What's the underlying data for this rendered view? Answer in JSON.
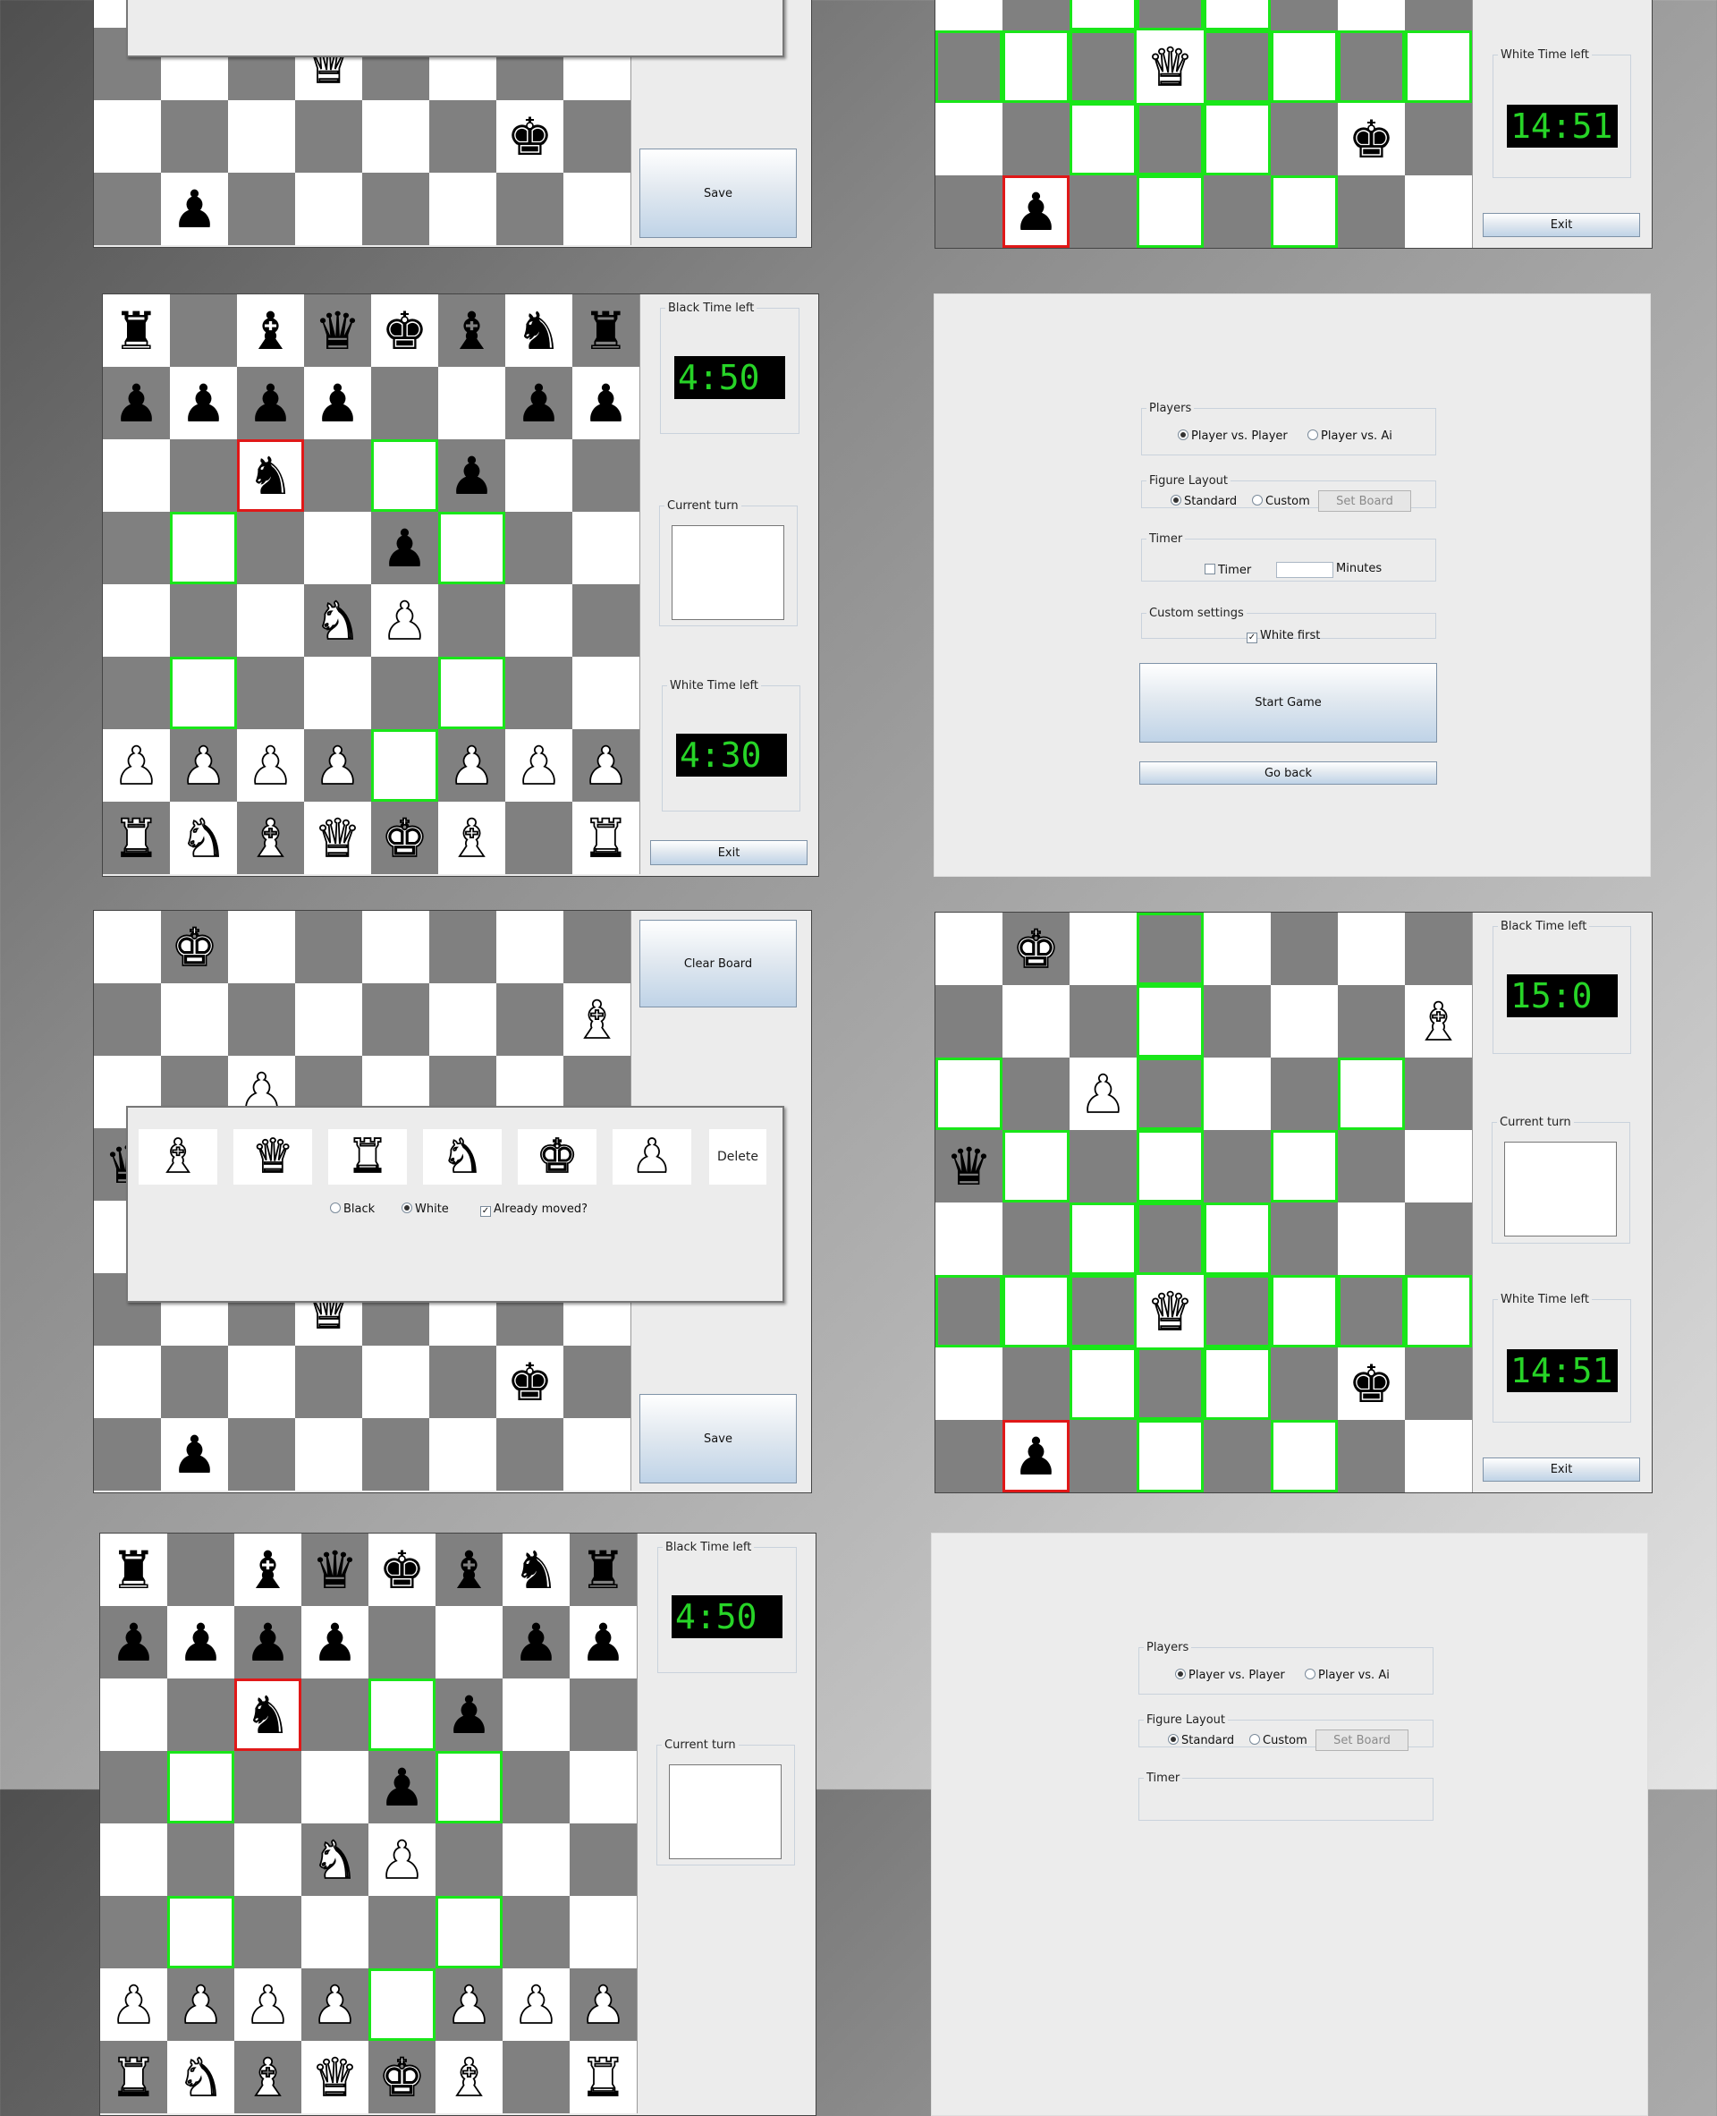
{
  "labels": {
    "black_time": "Black Time left",
    "white_time": "White Time left",
    "current_turn": "Current turn",
    "exit": "Exit",
    "save": "Save",
    "clear_board": "Clear Board",
    "players": "Players",
    "pvp": "Player vs. Player",
    "pva": "Player vs. Ai",
    "figure_layout": "Figure Layout",
    "standard": "Standard",
    "custom": "Custom",
    "set_board": "Set Board",
    "timer": "Timer",
    "timer_check": "Timer",
    "minutes": "Minutes",
    "custom_settings": "Custom settings",
    "white_first": "White first",
    "start_game": "Start Game",
    "go_back": "Go back",
    "delete": "Delete",
    "black": "Black",
    "white": "White",
    "already_moved": "Already moved?"
  },
  "timers": {
    "endgame_black": "15:0",
    "endgame_white": "14:51",
    "opening_black": "4:50",
    "opening_white": "4:30"
  },
  "boards": {
    "opening": [
      [
        "br",
        "",
        "bb",
        "bq",
        "bk",
        "bb",
        "bn",
        "br"
      ],
      [
        "bp",
        "bp",
        "bp",
        "bp",
        "",
        "",
        "bp",
        "bp"
      ],
      [
        "",
        "",
        "bn",
        "",
        "",
        "bp",
        "",
        ""
      ],
      [
        "",
        "",
        "",
        "",
        "bp",
        "",
        "",
        ""
      ],
      [
        "",
        "",
        "",
        "wn",
        "wp",
        "",
        "",
        ""
      ],
      [
        "",
        "",
        "",
        "",
        "",
        "",
        "",
        ""
      ],
      [
        "wp",
        "wp",
        "wp",
        "wp",
        "",
        "wp",
        "wp",
        "wp"
      ],
      [
        "wr",
        "wn",
        "wb",
        "wq",
        "wk",
        "wb",
        "",
        "wr"
      ]
    ],
    "endgame": [
      [
        "",
        "wk",
        "",
        "",
        "",
        "",
        "",
        ""
      ],
      [
        "",
        "",
        "",
        "",
        "",
        "",
        "",
        "wb"
      ],
      [
        "",
        "",
        "wp",
        "",
        "",
        "",
        "",
        ""
      ],
      [
        "bq",
        "",
        "",
        "",
        "",
        "",
        "",
        ""
      ],
      [
        "",
        "",
        "",
        "",
        "",
        "",
        "",
        ""
      ],
      [
        "",
        "",
        "",
        "wq",
        "",
        "",
        "",
        ""
      ],
      [
        "",
        "",
        "",
        "",
        "",
        "",
        "bk",
        ""
      ],
      [
        "",
        "bp",
        "",
        "",
        "",
        "",
        "",
        ""
      ]
    ],
    "editor": [
      [
        "",
        "wk",
        "",
        "",
        "",
        "",
        "",
        ""
      ],
      [
        "",
        "",
        "",
        "",
        "",
        "",
        "",
        "wb"
      ],
      [
        "",
        "",
        "wp",
        "",
        "",
        "",
        "",
        ""
      ],
      [
        "bq",
        "",
        "",
        "",
        "",
        "",
        "",
        ""
      ],
      [
        "",
        "",
        "",
        "",
        "",
        "",
        "",
        ""
      ],
      [
        "",
        "",
        "",
        "wq",
        "",
        "",
        "",
        ""
      ],
      [
        "",
        "",
        "",
        "",
        "",
        "",
        "bk",
        ""
      ],
      [
        "",
        "bp",
        "",
        "",
        "",
        "",
        "",
        ""
      ]
    ]
  },
  "highlights": {
    "opening": {
      "green": [
        [
          2,
          4
        ],
        [
          3,
          1
        ],
        [
          3,
          5
        ],
        [
          5,
          1
        ],
        [
          5,
          5
        ],
        [
          6,
          4
        ]
      ],
      "red": [
        [
          2,
          2
        ]
      ]
    },
    "endgame": {
      "green": [
        [
          0,
          3
        ],
        [
          1,
          3
        ],
        [
          2,
          0
        ],
        [
          2,
          3
        ],
        [
          2,
          6
        ],
        [
          3,
          1
        ],
        [
          3,
          3
        ],
        [
          3,
          5
        ],
        [
          4,
          2
        ],
        [
          4,
          3
        ],
        [
          4,
          4
        ],
        [
          5,
          0
        ],
        [
          5,
          1
        ],
        [
          5,
          2
        ],
        [
          5,
          4
        ],
        [
          5,
          5
        ],
        [
          5,
          6
        ],
        [
          5,
          7
        ],
        [
          6,
          2
        ],
        [
          6,
          3
        ],
        [
          6,
          4
        ],
        [
          7,
          3
        ],
        [
          7,
          5
        ]
      ],
      "red": [
        [
          7,
          1
        ]
      ]
    },
    "editor": {
      "green": [],
      "red": []
    }
  },
  "palette": [
    {
      "piece": "wb",
      "name": "white-bishop"
    },
    {
      "piece": "wq",
      "name": "white-queen"
    },
    {
      "piece": "wr",
      "name": "white-rook"
    },
    {
      "piece": "wn",
      "name": "white-knight"
    },
    {
      "piece": "wk",
      "name": "white-king"
    },
    {
      "piece": "wp",
      "name": "white-pawn"
    }
  ],
  "glyphs": {
    "k": "♚",
    "q": "♛",
    "r": "♜",
    "b": "♝",
    "n": "♞",
    "p": "♟"
  },
  "colors": {
    "highlight_move": "#19e619",
    "highlight_selected": "#e01818",
    "timer_text": "#27d427",
    "board_dark": "#808080",
    "board_light": "#ffffff"
  }
}
